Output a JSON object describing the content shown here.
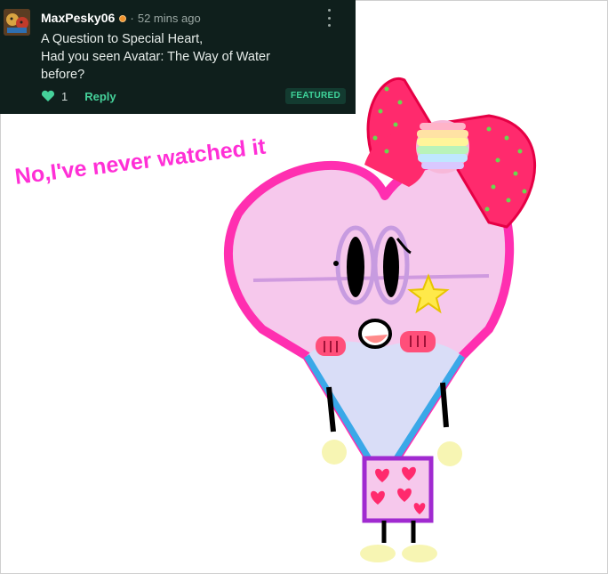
{
  "comment": {
    "username": "MaxPesky06",
    "separator": "·",
    "time": "52 mins ago",
    "lines": [
      "A Question to Special Heart,",
      "Had you seen Avatar: The Way of Water",
      "before?"
    ],
    "likes": "1",
    "reply_label": "Reply",
    "featured_label": "FEATURED"
  },
  "answer": "No,I've never watched it",
  "colors": {
    "comment_bg": "#0f1f1c",
    "accent_green": "#45d19a",
    "answer_pink": "#ff2fd6"
  }
}
